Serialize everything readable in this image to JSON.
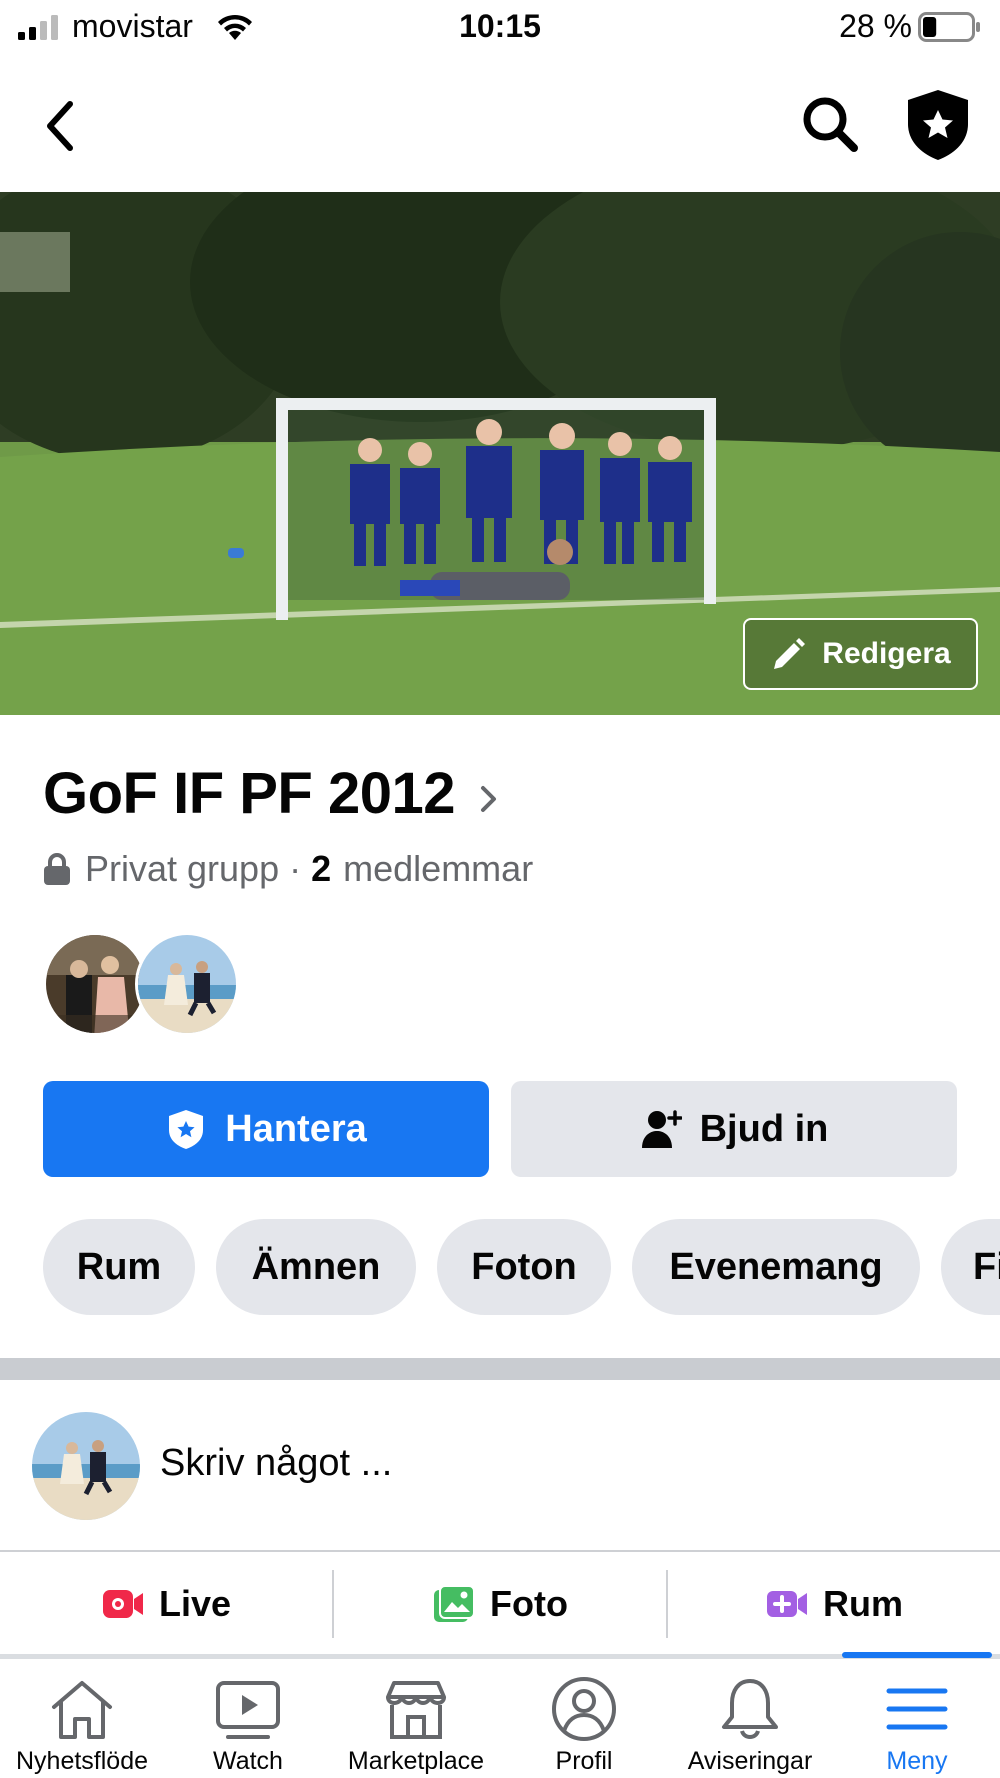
{
  "status_bar": {
    "carrier": "movistar",
    "time": "10:15",
    "battery_percent": "28 %",
    "battery_level": 0.28
  },
  "nav": {
    "back_icon": "chevron-left-icon",
    "search_icon": "search-icon",
    "admin_icon": "admin-shield-icon"
  },
  "cover": {
    "edit_label": "Redigera"
  },
  "group": {
    "name": "GoF IF PF 2012",
    "privacy": "Privat grupp",
    "separator": "·",
    "member_count": "2",
    "member_word": "medlemmar"
  },
  "actions": {
    "manage_label": "Hantera",
    "invite_label": "Bjud in"
  },
  "chips": [
    "Rum",
    "Ämnen",
    "Foton",
    "Evenemang",
    "Fi"
  ],
  "composer": {
    "placeholder": "Skriv något ..."
  },
  "post_actions": {
    "live_label": "Live",
    "photo_label": "Foto",
    "room_label": "Rum",
    "live_color": "#f02849",
    "photo_color": "#45bd62",
    "room_color": "#a35fe3"
  },
  "tabs": [
    {
      "label": "Nyhetsflöde",
      "icon": "home-icon"
    },
    {
      "label": "Watch",
      "icon": "watch-icon"
    },
    {
      "label": "Marketplace",
      "icon": "marketplace-icon"
    },
    {
      "label": "Profil",
      "icon": "profile-icon"
    },
    {
      "label": "Aviseringar",
      "icon": "bell-icon"
    },
    {
      "label": "Meny",
      "icon": "menu-icon",
      "active": true
    }
  ],
  "colors": {
    "accent": "#1877f2",
    "chip_bg": "#e4e6eb",
    "secondary_text": "#65676b"
  }
}
